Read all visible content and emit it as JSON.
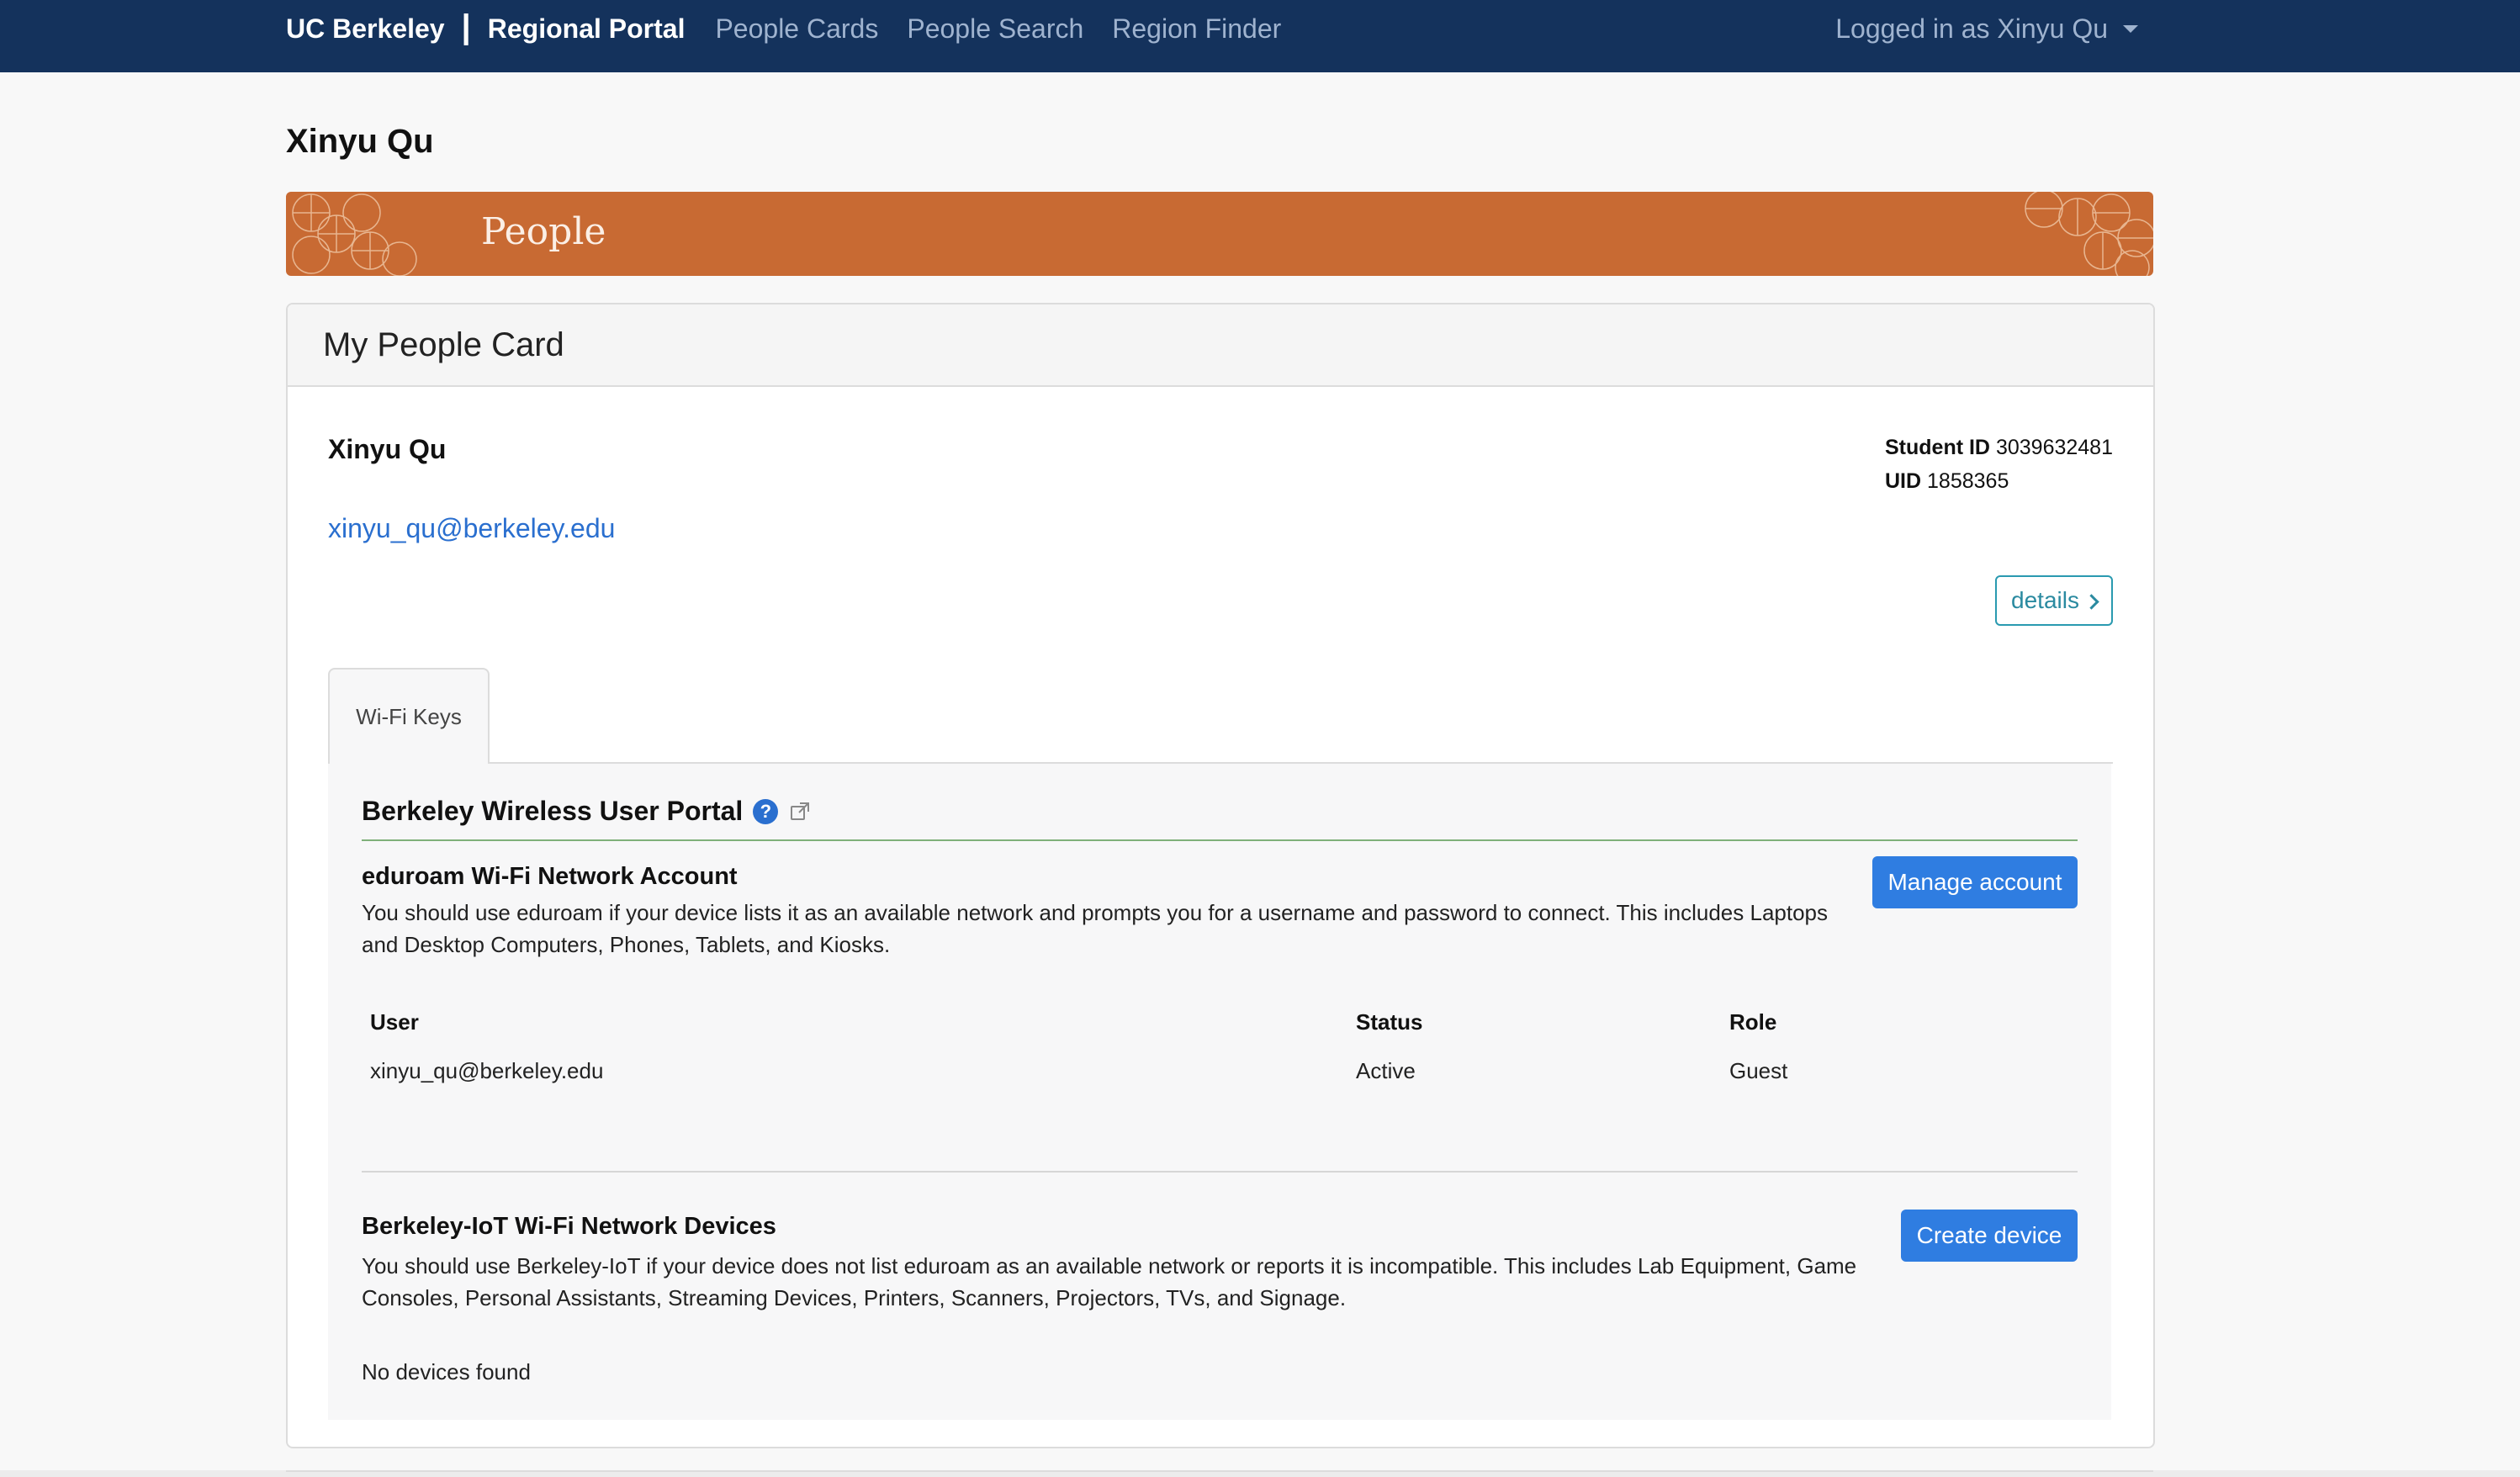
{
  "navbar": {
    "brand": "UC Berkeley",
    "separator": "|",
    "portal": "Regional Portal",
    "links": [
      "People Cards",
      "People Search",
      "Region Finder"
    ],
    "user_menu": "Logged in as Xinyu Qu"
  },
  "page": {
    "title": "Xinyu Qu"
  },
  "banner": {
    "title": "People"
  },
  "card": {
    "title": "My People Card",
    "name": "Xinyu Qu",
    "email": "xinyu_qu@berkeley.edu",
    "student_id_label": "Student ID",
    "student_id": "3039632481",
    "uid_label": "UID",
    "uid": "1858365",
    "details_label": "details"
  },
  "tabs": [
    {
      "label": "Wi-Fi Keys",
      "active": true
    }
  ],
  "wifi": {
    "heading": "Berkeley Wireless User Portal",
    "eduroam": {
      "title": "eduroam Wi-Fi Network Account",
      "description": "You should use eduroam if your device lists it as an available network and prompts you for a username and password to connect. This includes Laptops and Desktop Computers, Phones, Tablets, and Kiosks.",
      "button": "Manage account",
      "columns": [
        "User",
        "Status",
        "Role"
      ],
      "rows": [
        [
          "xinyu_qu@berkeley.edu",
          "Active",
          "Guest"
        ]
      ]
    },
    "iot": {
      "title": "Berkeley-IoT Wi-Fi Network Devices",
      "description": "You should use Berkeley-IoT if your device does not list eduroam as an available network or reports it is incompatible. This includes Lab Equipment, Game Consoles, Personal Assistants, Streaming Devices, Printers, Scanners, Projectors, TVs, and Signage.",
      "button": "Create device",
      "empty": "No devices found"
    }
  },
  "colors": {
    "navbar": "#14325c",
    "banner": "#c86a33",
    "link": "#2a6fcf",
    "primary_button": "#2f7de1",
    "outline_button": "#2a9ab0"
  }
}
